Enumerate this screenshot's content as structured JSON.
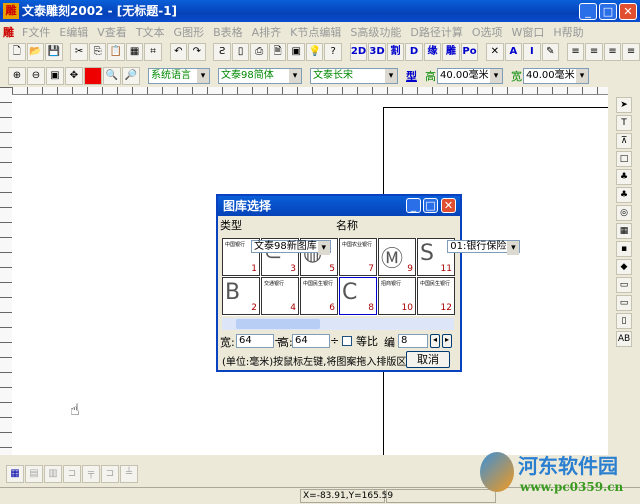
{
  "window": {
    "title": "文泰雕刻2002 - [无标题-1]",
    "app_icon": "雕"
  },
  "menu": [
    "F文件",
    "E编辑",
    "V查看",
    "T文本",
    "G图形",
    "B表格",
    "A排齐",
    "K节点编辑",
    "S高级功能",
    "D路径计算",
    "O选项",
    "W窗口",
    "H帮助"
  ],
  "toolbar1": [
    "new",
    "open",
    "save",
    "cut",
    "copy",
    "paste",
    "grid",
    "trace",
    "undo",
    "redo",
    "scan",
    "card",
    "print",
    "preview",
    "frame",
    "bulb",
    "help",
    "2D",
    "3D",
    "割",
    "D",
    "缘",
    "雕",
    "Po",
    "pin",
    "A",
    "I",
    "edit",
    "left",
    "center",
    "right",
    "justify"
  ],
  "toolbar2": {
    "icons": [
      "zoom-in",
      "zoom-out",
      "zoom-box",
      "move",
      "color-red",
      "zoom-page",
      "zoom-all"
    ],
    "language": "系统语言",
    "font1": "文泰98简体",
    "font2": "文泰长宋",
    "style_button": "型",
    "height_label": "高",
    "height": "40.00毫米",
    "width_label": "宽",
    "width": "40.00毫米"
  },
  "dialog": {
    "title": "图库选择",
    "type_label": "类型",
    "type_value": "文泰98新图库",
    "name_label": "名称",
    "name_value": "01:银行保险",
    "cells": [
      {
        "n": "1",
        "g": "中国银行"
      },
      {
        "n": "3",
        "g": "⊂"
      },
      {
        "n": "5",
        "g": "◍"
      },
      {
        "n": "7",
        "g": "中国农业银行"
      },
      {
        "n": "9",
        "g": "Ⓜ"
      },
      {
        "n": "11",
        "g": "S"
      },
      {
        "n": "2",
        "g": "B"
      },
      {
        "n": "4",
        "g": "交通银行"
      },
      {
        "n": "6",
        "g": "中国民生银行"
      },
      {
        "n": "8",
        "g": "C"
      },
      {
        "n": "10",
        "g": "招商银行"
      },
      {
        "n": "12",
        "g": "中国民生银行"
      }
    ],
    "width_label": "宽:",
    "width_value": "64",
    "height_label": "高:",
    "height_value": "64",
    "ratio_label": "等比",
    "index_label": "编",
    "index_value": "8",
    "hint": "(单位:毫米)按鼠标左键,将图案拖入排版区",
    "cancel": "取消"
  },
  "status": {
    "coords": "X=-83.91,Y=165.59"
  },
  "watermark": {
    "name": "河东软件园",
    "url": "www.pc0359.cn"
  }
}
